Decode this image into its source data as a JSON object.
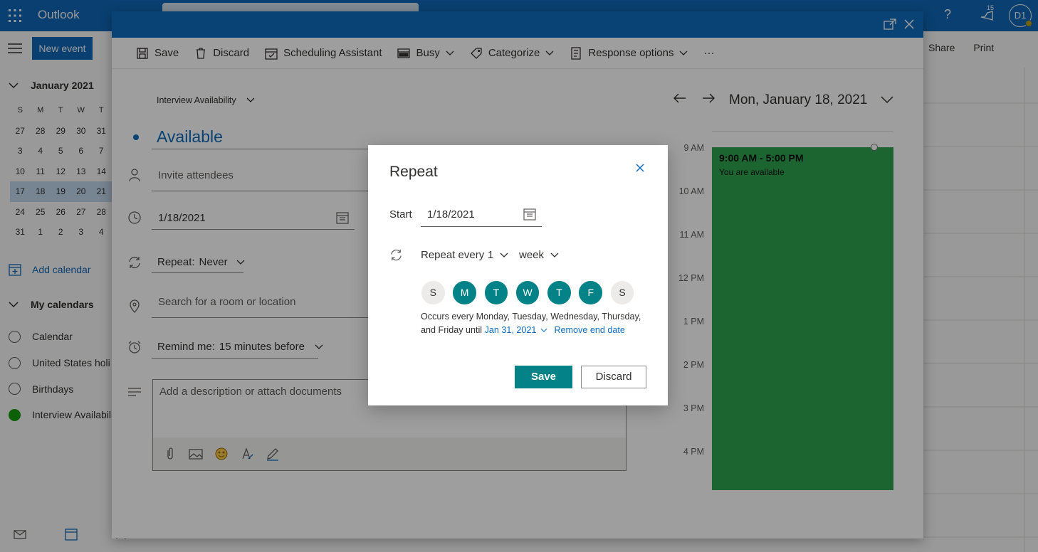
{
  "app": {
    "name": "Outlook",
    "notification_count": "15",
    "avatar_initials": "D1"
  },
  "base": {
    "new_event_label": "New event",
    "mini_calendar": {
      "month_label": "January 2021",
      "weekday_headers": [
        "S",
        "M",
        "T",
        "W",
        "T"
      ],
      "rows": [
        [
          "27",
          "28",
          "29",
          "30",
          "31"
        ],
        [
          "3",
          "4",
          "5",
          "6",
          "7"
        ],
        [
          "10",
          "11",
          "12",
          "13",
          "14"
        ],
        [
          "17",
          "18",
          "19",
          "20",
          "21"
        ],
        [
          "24",
          "25",
          "26",
          "27",
          "28"
        ],
        [
          "31",
          "1",
          "2",
          "3",
          "4"
        ]
      ]
    },
    "add_calendar_label": "Add calendar",
    "my_calendars_label": "My calendars",
    "calendars": [
      "Calendar",
      "United States holi",
      "Birthdays",
      "Interview Availabili"
    ],
    "share_label": "Share",
    "print_label": "Print"
  },
  "editor": {
    "ribbon": {
      "save": "Save",
      "discard": "Discard",
      "scheduling": "Scheduling Assistant",
      "busy": "Busy",
      "categorize": "Categorize",
      "response": "Response options",
      "more": "···"
    },
    "calendar_picker": "Interview Availability",
    "title": "Available",
    "invite_placeholder": "Invite attendees",
    "date_value": "1/18/2021",
    "repeat_label": "Repeat:",
    "repeat_value": "Never",
    "location_placeholder": "Search for a room or location",
    "remind_label": "Remind me:",
    "remind_value": "15 minutes before",
    "description_placeholder": "Add a description or attach documents"
  },
  "day_view": {
    "date_title": "Mon, January 18, 2021",
    "hours": [
      "9 AM",
      "10 AM",
      "11 AM",
      "12 PM",
      "1 PM",
      "2 PM",
      "3 PM",
      "4 PM"
    ],
    "event_time": "9:00 AM - 5:00 PM",
    "event_text": "You are available",
    "event_color": "#2ea44f"
  },
  "repeat_dialog": {
    "title": "Repeat",
    "start_label": "Start",
    "start_value": "1/18/2021",
    "repeat_every_label": "Repeat every",
    "interval": "1",
    "unit": "week",
    "days": [
      {
        "letter": "S",
        "selected": false
      },
      {
        "letter": "M",
        "selected": true
      },
      {
        "letter": "T",
        "selected": true
      },
      {
        "letter": "W",
        "selected": true
      },
      {
        "letter": "T",
        "selected": true
      },
      {
        "letter": "F",
        "selected": true
      },
      {
        "letter": "S",
        "selected": false
      }
    ],
    "occurs_text": "Occurs every Monday, Tuesday, Wednesday, Thursday, and Friday until",
    "until_date": "Jan 31, 2021",
    "remove_end_date": "Remove end date",
    "save_label": "Save",
    "discard_label": "Discard",
    "accent_color": "#038387"
  }
}
